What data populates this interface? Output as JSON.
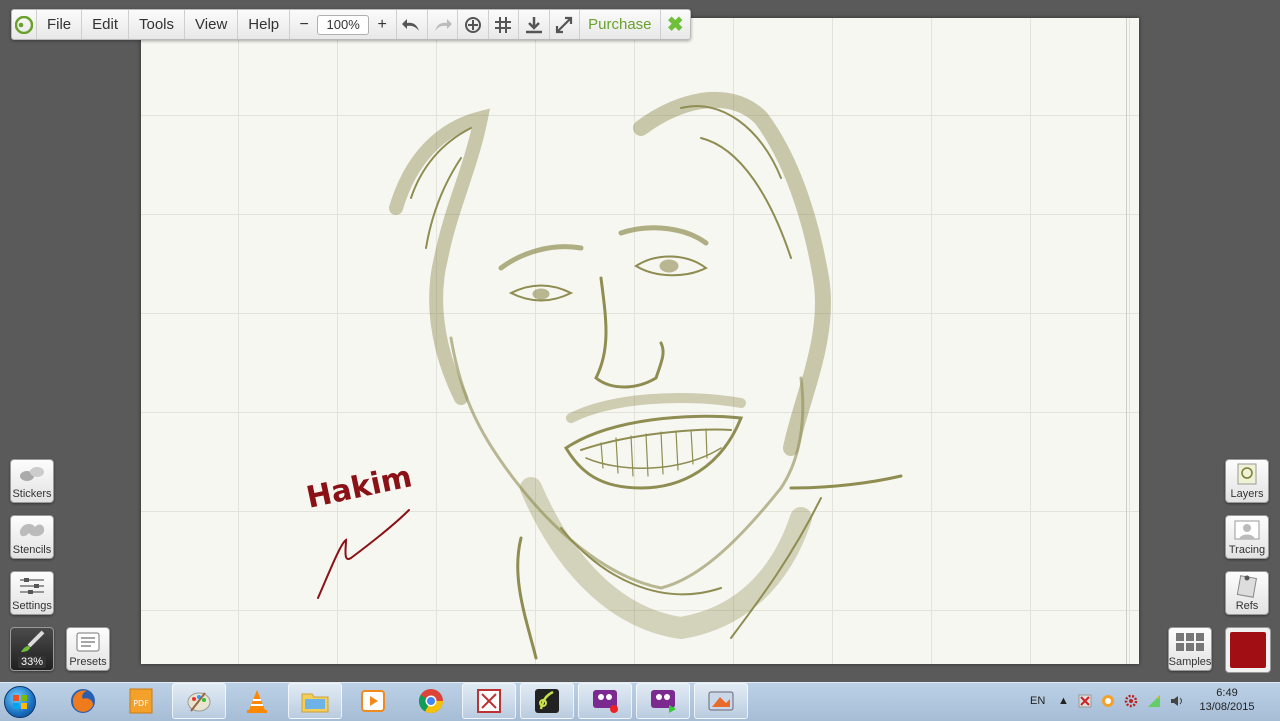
{
  "menu": {
    "file": "File",
    "edit": "Edit",
    "tools": "Tools",
    "view": "View",
    "help": "Help"
  },
  "zoom": {
    "minus": "−",
    "value": "100%",
    "plus": "+"
  },
  "toolbar": {
    "purchase": "Purchase"
  },
  "canvas": {
    "signature_text": "Hakim",
    "ink_color": "#8a1116",
    "sketch_color": "#7d7a35"
  },
  "left_panel": {
    "stickers": "Stickers",
    "stencils": "Stencils",
    "settings": "Settings",
    "brush_size": "33%",
    "presets": "Presets"
  },
  "right_panel": {
    "layers": "Layers",
    "tracing": "Tracing",
    "refs": "Refs",
    "samples": "Samples",
    "current_color": "#a10f15"
  },
  "taskbar": {
    "apps": [
      "firefox-icon",
      "pdf-icon",
      "paint-icon",
      "vlc-icon",
      "explorer-icon",
      "media-player-icon",
      "chrome-icon",
      "app-icon",
      "artrage-icon",
      "recorder-icon",
      "recorder-icon",
      "media-icon"
    ]
  },
  "tray": {
    "lang": "EN",
    "time": "6:49",
    "date": "13/08/2015"
  }
}
